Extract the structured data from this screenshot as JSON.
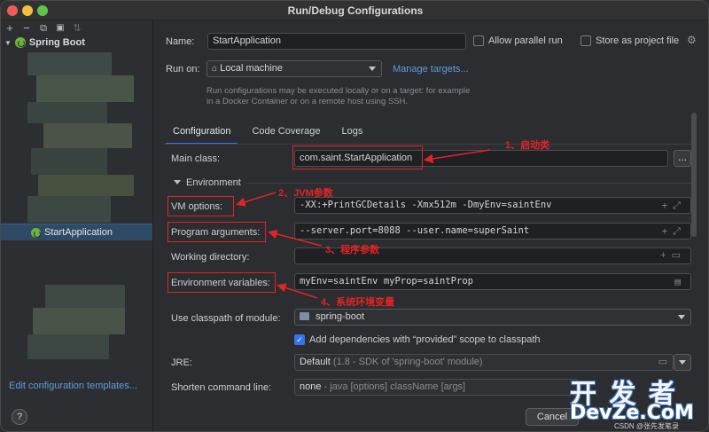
{
  "window": {
    "title": "Run/Debug Configurations"
  },
  "toolbar": {
    "add": "+",
    "remove": "−",
    "copy": "⧉",
    "folder": "▣",
    "sort": "⇅"
  },
  "tree": {
    "root_label": "Spring Boot",
    "selected_label": "StartApplication"
  },
  "left_footer": {
    "edit_templates": "Edit configuration templates..."
  },
  "help": "?",
  "form": {
    "name_label": "Name:",
    "name_value": "StartApplication",
    "allow_parallel_label": "Allow parallel run",
    "store_project_label": "Store as project file",
    "run_on_label": "Run on:",
    "run_on_value": "Local machine",
    "manage_targets": "Manage targets...",
    "run_on_hint": "Run configurations may be executed locally or on a target: for example in a Docker Container or on a remote host using SSH."
  },
  "tabs": [
    "Configuration",
    "Code Coverage",
    "Logs"
  ],
  "config": {
    "main_class_label": "Main class:",
    "main_class_value": "com.saint.StartApplication",
    "main_class_browse": "...",
    "environment_label": "Environment",
    "vm_options_label": "VM options:",
    "vm_options_value": "-XX:+PrintGCDetails -Xmx512m -DmyEnv=saintEnv",
    "program_args_label": "Program arguments:",
    "program_args_value": "--server.port=8088 --user.name=superSaint",
    "working_dir_label": "Working directory:",
    "working_dir_value": "",
    "env_vars_label": "Environment variables:",
    "env_vars_value": "myEnv=saintEnv myProp=saintProp",
    "classpath_label": "Use classpath of module:",
    "classpath_value": "spring-boot",
    "add_deps_label": "Add dependencies with “provided” scope to classpath",
    "jre_label": "JRE:",
    "jre_value": "Default",
    "jre_detail": "(1.8 - SDK of 'spring-boot' module)",
    "shorten_label": "Shorten command line:",
    "shorten_value": "none",
    "shorten_detail": "- java [options] className [args]"
  },
  "annotations": {
    "a1": "1、启动类",
    "a2": "2、JVM参数",
    "a3": "3、程序参数",
    "a4": "4、系统环境变量"
  },
  "footer": {
    "cancel": "Cancel"
  },
  "watermark": {
    "cn": "开 发 者",
    "en": "DevZe.CoM",
    "small": "CSDN @张先发笔录"
  },
  "colors": {
    "accent": "#3574f0",
    "annotation": "#e12424",
    "link": "#5a9fe0",
    "spring": "#6cb33e"
  }
}
